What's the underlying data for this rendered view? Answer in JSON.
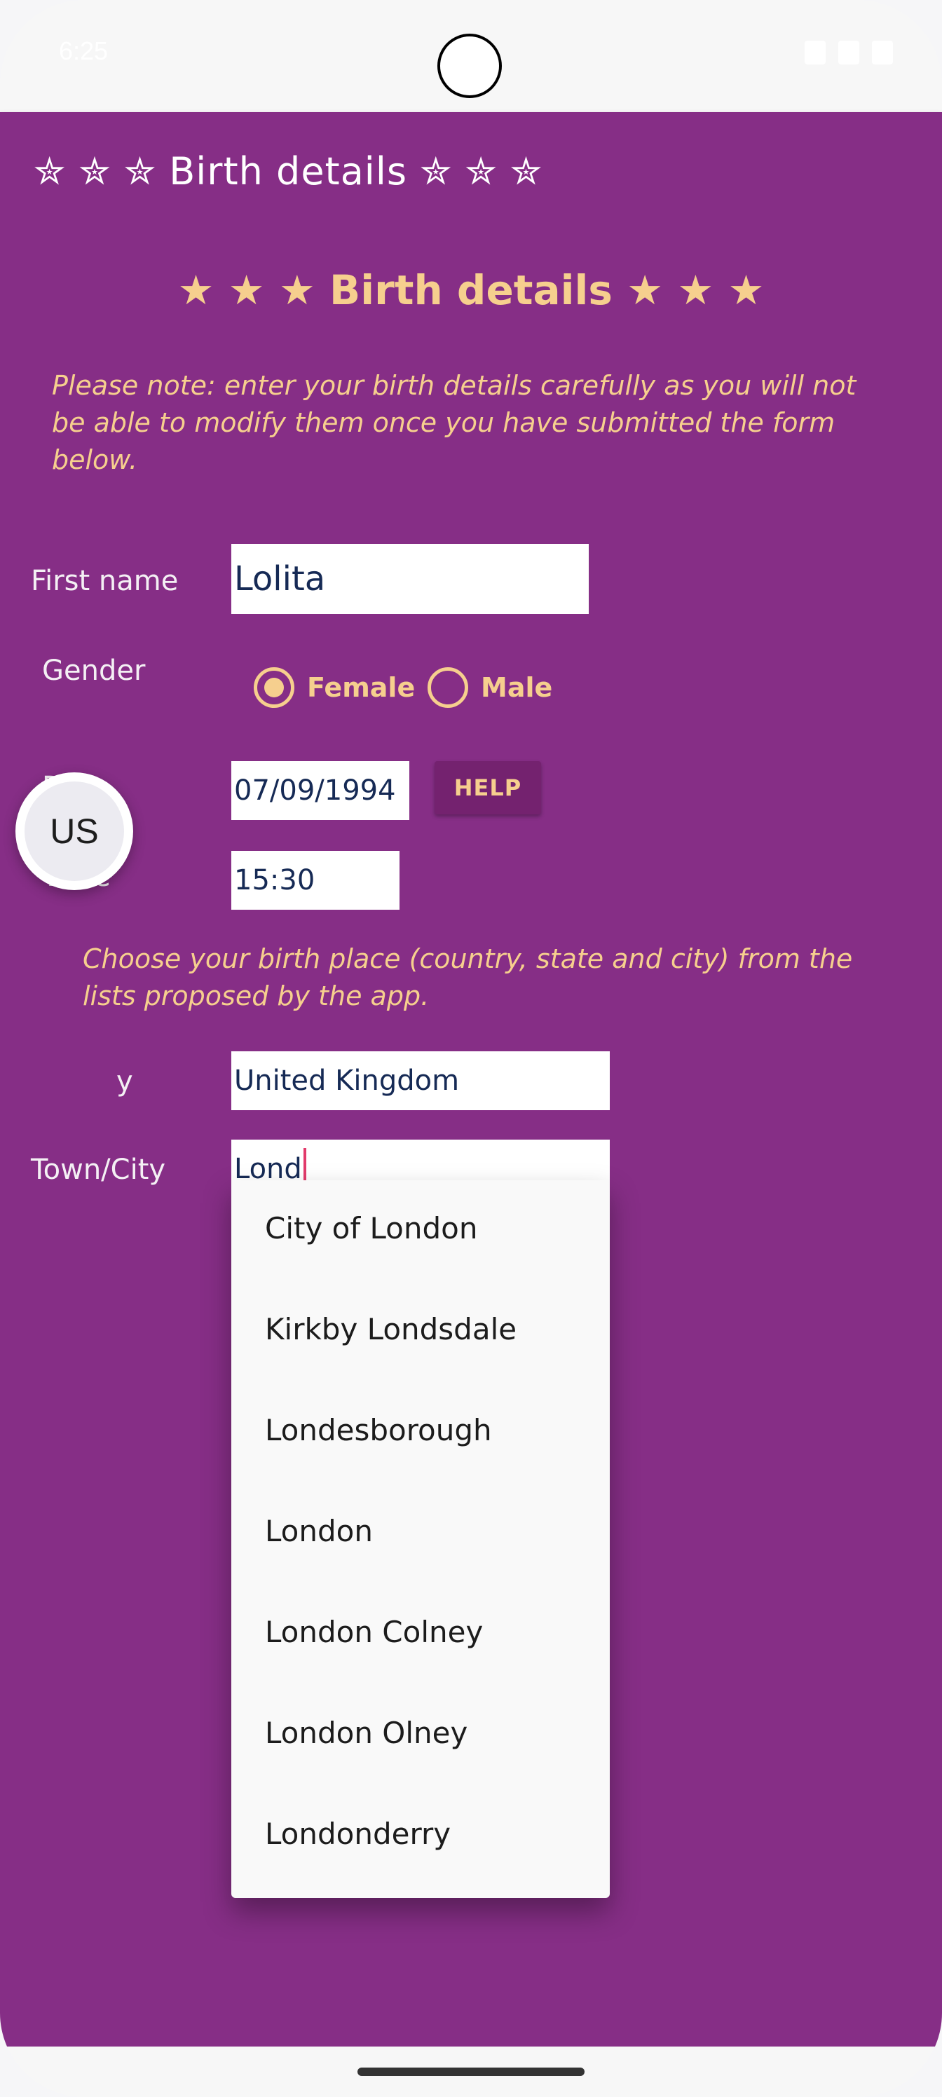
{
  "status_bar": {
    "time": "6:25"
  },
  "app_bar": {
    "title": "✮ ✮ ✮ Birth details ✮ ✮ ✮"
  },
  "form": {
    "page_title": "★ ★ ★ Birth details ★ ★ ★",
    "note": "Please note: enter your birth details carefully as you will not be able to modify them once you have submitted the form below.",
    "first_name": {
      "label": "First name",
      "value": "Lolita"
    },
    "gender": {
      "label": "Gender",
      "options": [
        {
          "label": "Female",
          "selected": true
        },
        {
          "label": "Male",
          "selected": false
        }
      ]
    },
    "date": {
      "label": "Date",
      "value": "07/09/1994",
      "help_label": "HELP"
    },
    "time": {
      "label": "Time",
      "value": "15:30"
    },
    "place_hint": "Choose your birth place (country, state and city) from the lists proposed by the app.",
    "country": {
      "label": "Country",
      "label_visible": "y",
      "value": "United Kingdom"
    },
    "town": {
      "label": "Town/City",
      "value": "Lond"
    }
  },
  "floating_bubble": {
    "label": "US"
  },
  "suggestions": [
    "City of London",
    "Kirkby Londsdale",
    "Londesborough",
    "London",
    "London Colney",
    "London Olney",
    "Londonderry"
  ],
  "colors": {
    "background": "#862e86",
    "accent": "#f6cf8e",
    "help_button": "#74226f",
    "caret": "#e23a6b"
  }
}
